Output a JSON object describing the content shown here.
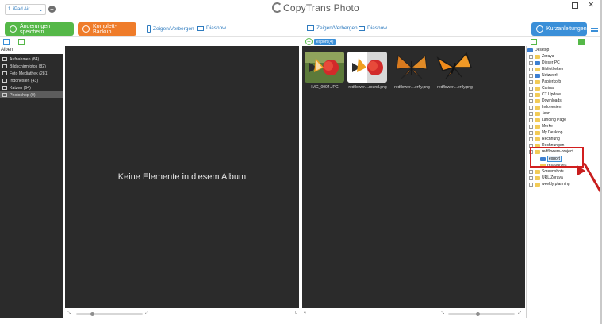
{
  "app": {
    "title": "CopyTrans Photo"
  },
  "device": {
    "selected": "1. iPad Air"
  },
  "toolbar": {
    "save_label": "Änderungen speichern",
    "backup_label": "Komplett-Backup",
    "quick_label": "Kurzanleitungen",
    "left_toggle": "Zeigen/Verbergen",
    "left_slideshow": "Diashow",
    "right_toggle": "Zeigen/Verbergen",
    "right_slideshow": "Diashow"
  },
  "albums": {
    "title": "Alben",
    "items": [
      {
        "label": "Aufnahmen (84)"
      },
      {
        "label": "Bildschirmfotos (82)"
      },
      {
        "label": "Foto Mediathek (281)"
      },
      {
        "label": "Indonesien (43)"
      },
      {
        "label": "Katzen (64)"
      },
      {
        "label": "Photoshop (0)"
      }
    ]
  },
  "device_panel": {
    "empty_message": "Keine Elemente in diesem Album",
    "count": "0"
  },
  "pc_panel": {
    "folder_tag": "export (4)",
    "count": "4",
    "thumbnails": [
      {
        "label": "IMG_0004.JPG"
      },
      {
        "label": "redflower....round.png"
      },
      {
        "label": "redflower....erfly.png"
      },
      {
        "label": "redflower....erfly.png"
      }
    ]
  },
  "tree": {
    "items": [
      {
        "label": "Desktop"
      },
      {
        "label": "Zoraya"
      },
      {
        "label": "Dieser PC"
      },
      {
        "label": "Bibliotheken"
      },
      {
        "label": "Netzwerk"
      },
      {
        "label": "Papierkorb"
      },
      {
        "label": "Carina"
      },
      {
        "label": "CT Update"
      },
      {
        "label": "Downloads"
      },
      {
        "label": "Indonesien"
      },
      {
        "label": "Jean"
      },
      {
        "label": "Landing Page"
      },
      {
        "label": "Merke"
      },
      {
        "label": "My Desktop"
      },
      {
        "label": "Rechnung"
      },
      {
        "label": "Rechnungen"
      },
      {
        "label": "redflowers-project"
      },
      {
        "label": "export"
      },
      {
        "label": "ressources"
      },
      {
        "label": "Screenshots"
      },
      {
        "label": "URL Zoraya"
      },
      {
        "label": "weekly planning"
      }
    ]
  },
  "colors": {
    "accent": "#3a8fd8",
    "save": "#55b848",
    "backup": "#ef7c2a",
    "panel": "#2b2b2b",
    "annotation": "#d21f1f"
  }
}
